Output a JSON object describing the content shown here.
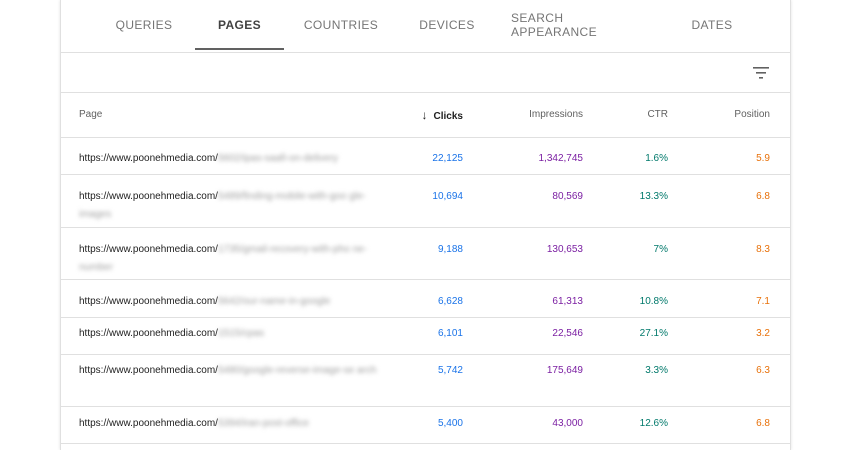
{
  "colors": {
    "clicks": "#1a73e8",
    "impressions": "#7b1fa2",
    "ctr": "#00796b",
    "position": "#e8710a"
  },
  "tabs": [
    {
      "label": "QUERIES"
    },
    {
      "label": "PAGES"
    },
    {
      "label": "COUNTRIES"
    },
    {
      "label": "DEVICES"
    },
    {
      "label": "SEARCH APPEARANCE"
    },
    {
      "label": "DATES"
    }
  ],
  "active_tab": "PAGES",
  "toolbar": {
    "filter_icon": "filter-icon"
  },
  "table": {
    "columns": {
      "page": "Page",
      "clicks": "Clicks",
      "impressions": "Impressions",
      "ctr": "CTR",
      "position": "Position"
    },
    "sort_icon": "arrow-down-icon",
    "rows": [
      {
        "url": "https://www.poonehmedia.com/",
        "slug": "5602/ipas-saafi-on-delivery",
        "clicks": "22,125",
        "impressions": "1,342,745",
        "ctr": "1.6%",
        "position": "5.9"
      },
      {
        "url": "https://www.poonehmedia.com/",
        "slug": "5489/finding-mobile-with-goo gle-images",
        "clicks": "10,694",
        "impressions": "80,569",
        "ctr": "13.3%",
        "position": "6.8"
      },
      {
        "url": "https://www.poonehmedia.com/",
        "slug": "1735/gmail-recovery-with-pho ne-number",
        "clicks": "9,188",
        "impressions": "130,653",
        "ctr": "7%",
        "position": "8.3"
      },
      {
        "url": "https://www.poonehmedia.com/",
        "slug": "5642/our-name-in-google",
        "clicks": "6,628",
        "impressions": "61,313",
        "ctr": "10.8%",
        "position": "7.1"
      },
      {
        "url": "https://www.poonehmedia.com/",
        "slug": "1515/cpas",
        "clicks": "6,101",
        "impressions": "22,546",
        "ctr": "27.1%",
        "position": "3.2"
      },
      {
        "url": "https://www.poonehmedia.com/",
        "slug": "5480/google-reverse-image-se arch",
        "clicks": "5,742",
        "impressions": "175,649",
        "ctr": "3.3%",
        "position": "6.3"
      },
      {
        "url": "https://www.poonehmedia.com/",
        "slug": "5394/iran-post-office",
        "clicks": "5,400",
        "impressions": "43,000",
        "ctr": "12.6%",
        "position": "6.8"
      }
    ]
  }
}
